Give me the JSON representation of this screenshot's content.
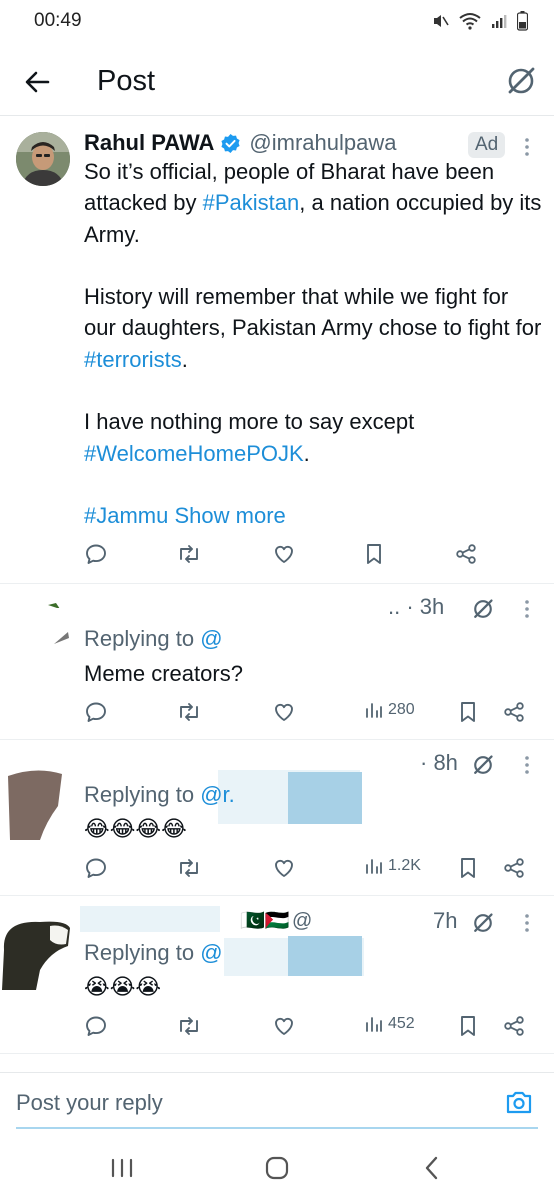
{
  "status_bar": {
    "time": "00:49"
  },
  "header": {
    "title": "Post"
  },
  "tweet": {
    "author_name": "Rahul PAWA",
    "handle": "@imrahulpawa",
    "ad_label": "Ad",
    "body": {
      "p1_a": "So it’s official, people of Bharat have been attacked by ",
      "p1_tag": "#Pakistan",
      "p1_b": ", a nation occupied by its Army.",
      "p2_a": "History will remember that while we  fight for our daughters, Pakistan Army chose to fight for ",
      "p2_tag": "#terrorists",
      "p2_b": ".",
      "p3_a": "I have nothing more to say except ",
      "p3_tag": "#WelcomeHomePOJK",
      "p3_b": ".",
      "p4_tag": "#Jammu",
      "show_more": "Show more"
    }
  },
  "replies": [
    {
      "meta": "..  · 3h",
      "replying_label": "Replying to ",
      "mention": "@",
      "text": "Meme creators?",
      "views": "280"
    },
    {
      "meta": "· 8h",
      "replying_label": "Replying to ",
      "mention": "@r.",
      "text": "😂😂😂😂",
      "views": "1.2K"
    },
    {
      "meta": "7h",
      "flags": "🇵🇰🇵🇸",
      "handle_fragment": "@",
      "replying_label": "Replying to ",
      "mention": "@",
      "text": "😭😭😭",
      "views": "452"
    }
  ],
  "reply_bar": {
    "placeholder": "Post your reply"
  },
  "colors": {
    "accent": "#1d8ed8",
    "secondary_text": "#536471",
    "text": "#0f1419",
    "verified": "#1d9bf0"
  }
}
